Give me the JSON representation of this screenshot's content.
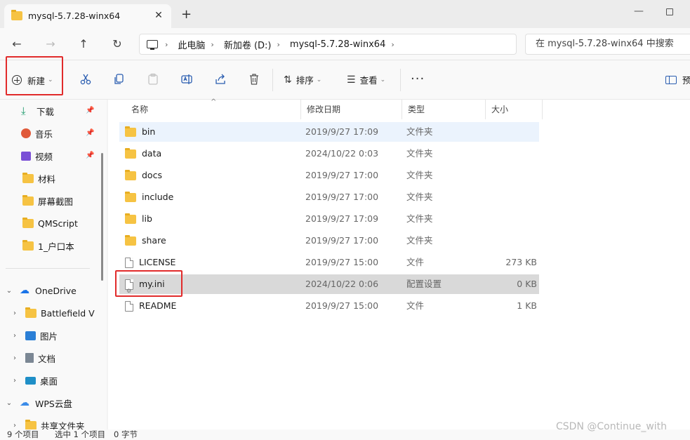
{
  "window": {
    "tab_title": "mysql-5.7.28-winx64",
    "tab_close": "✕",
    "new_tab": "+",
    "minimize": "—"
  },
  "nav": {
    "back": "←",
    "forward": "→",
    "up": "↑",
    "refresh": "↻"
  },
  "breadcrumb": {
    "separator": "›",
    "items": [
      "此电脑",
      "新加卷 (D:)",
      "mysql-5.7.28-winx64"
    ]
  },
  "search": {
    "placeholder": "在 mysql-5.7.28-winx64 中搜索"
  },
  "toolbar": {
    "new_label": "新建",
    "sort_label": "排序",
    "view_label": "查看",
    "more": "···",
    "preview_label": "预",
    "caret": "⌄"
  },
  "sidebar": {
    "quick": [
      {
        "label": "下载",
        "icon": "download-icon",
        "pinned": true
      },
      {
        "label": "音乐",
        "icon": "music-icon",
        "pinned": true
      },
      {
        "label": "视频",
        "icon": "video-icon",
        "pinned": true
      },
      {
        "label": "材料",
        "icon": "folder-icon",
        "pinned": false
      },
      {
        "label": "屏幕截图",
        "icon": "folder-icon",
        "pinned": false
      },
      {
        "label": "QMScript",
        "icon": "folder-icon",
        "pinned": false
      },
      {
        "label": "1_户口本",
        "icon": "folder-icon",
        "pinned": false
      }
    ],
    "onedrive_label": "OneDrive",
    "onedrive_children": [
      {
        "label": "Battlefield V",
        "icon": "folder-icon"
      },
      {
        "label": "图片",
        "icon": "pictures-icon"
      },
      {
        "label": "文档",
        "icon": "documents-icon"
      },
      {
        "label": "桌面",
        "icon": "desktop-icon"
      }
    ],
    "wps_label": "WPS云盘",
    "wps_child": "共享文件夹"
  },
  "columns": {
    "name": "名称",
    "modified": "修改日期",
    "type": "类型",
    "size": "大小",
    "sort_indicator": "^"
  },
  "files": [
    {
      "name": "bin",
      "date": "2019/9/27 17:09",
      "type": "文件夹",
      "size": "",
      "kind": "folder",
      "state": "hover"
    },
    {
      "name": "data",
      "date": "2024/10/22 0:03",
      "type": "文件夹",
      "size": "",
      "kind": "folder",
      "state": ""
    },
    {
      "name": "docs",
      "date": "2019/9/27 17:00",
      "type": "文件夹",
      "size": "",
      "kind": "folder",
      "state": ""
    },
    {
      "name": "include",
      "date": "2019/9/27 17:00",
      "type": "文件夹",
      "size": "",
      "kind": "folder",
      "state": ""
    },
    {
      "name": "lib",
      "date": "2019/9/27 17:09",
      "type": "文件夹",
      "size": "",
      "kind": "folder",
      "state": ""
    },
    {
      "name": "share",
      "date": "2019/9/27 17:00",
      "type": "文件夹",
      "size": "",
      "kind": "folder",
      "state": ""
    },
    {
      "name": "LICENSE",
      "date": "2019/9/27 15:00",
      "type": "文件",
      "size": "273 KB",
      "kind": "file",
      "state": ""
    },
    {
      "name": "my.ini",
      "date": "2024/10/22 0:06",
      "type": "配置设置",
      "size": "0 KB",
      "kind": "ini",
      "state": "selected"
    },
    {
      "name": "README",
      "date": "2019/9/27 15:00",
      "type": "文件",
      "size": "1 KB",
      "kind": "file",
      "state": ""
    }
  ],
  "status": {
    "count": "9 个项目",
    "selected": "选中 1 个项目",
    "bytes": "0 字节"
  },
  "watermark": "CSDN @Continue_with"
}
